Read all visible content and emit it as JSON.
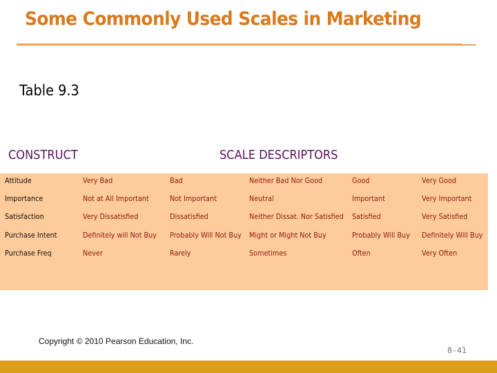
{
  "slide": {
    "title": "Some Commonly Used Scales in Marketing",
    "table_label": "Table 9.3",
    "copyright": "Copyright © 2010 Pearson Education, Inc.",
    "page_number": "8-41"
  },
  "colors": {
    "title": "#d97a1e",
    "title_rule": "#e8a05a",
    "header_text": "#5a0f5a",
    "table_background": "#fecb9a",
    "construct_text": "#111111",
    "descriptor_text": "#8a1a10",
    "bottom_bar": "#dca018"
  },
  "table": {
    "headers": {
      "construct": "CONSTRUCT",
      "descriptors": "SCALE DESCRIPTORS"
    },
    "rows": [
      {
        "construct": "Attitude",
        "descriptors": [
          "Very Bad",
          "Bad",
          "Neither Bad Nor Good",
          "Good",
          "Very Good"
        ]
      },
      {
        "construct": "Importance",
        "descriptors": [
          "Not at All Important",
          "Not Important",
          "Neutral",
          "Important",
          "Very Important"
        ]
      },
      {
        "construct": "Satisfaction",
        "descriptors": [
          "Very Dissatisfied",
          "Dissatisfied",
          "Neither Dissat. Nor Satisfied",
          "Satisfied",
          "Very Satisfied"
        ]
      },
      {
        "construct": "Purchase Intent",
        "descriptors": [
          "Definitely will Not Buy",
          "Probably Will Not Buy",
          "Might or Might Not Buy",
          "Probably Will Buy",
          "Definitely Will Buy"
        ]
      },
      {
        "construct": "Purchase Freq",
        "descriptors": [
          "Never",
          "Rarely",
          "Sometimes",
          "Often",
          "Very Often"
        ]
      }
    ]
  }
}
